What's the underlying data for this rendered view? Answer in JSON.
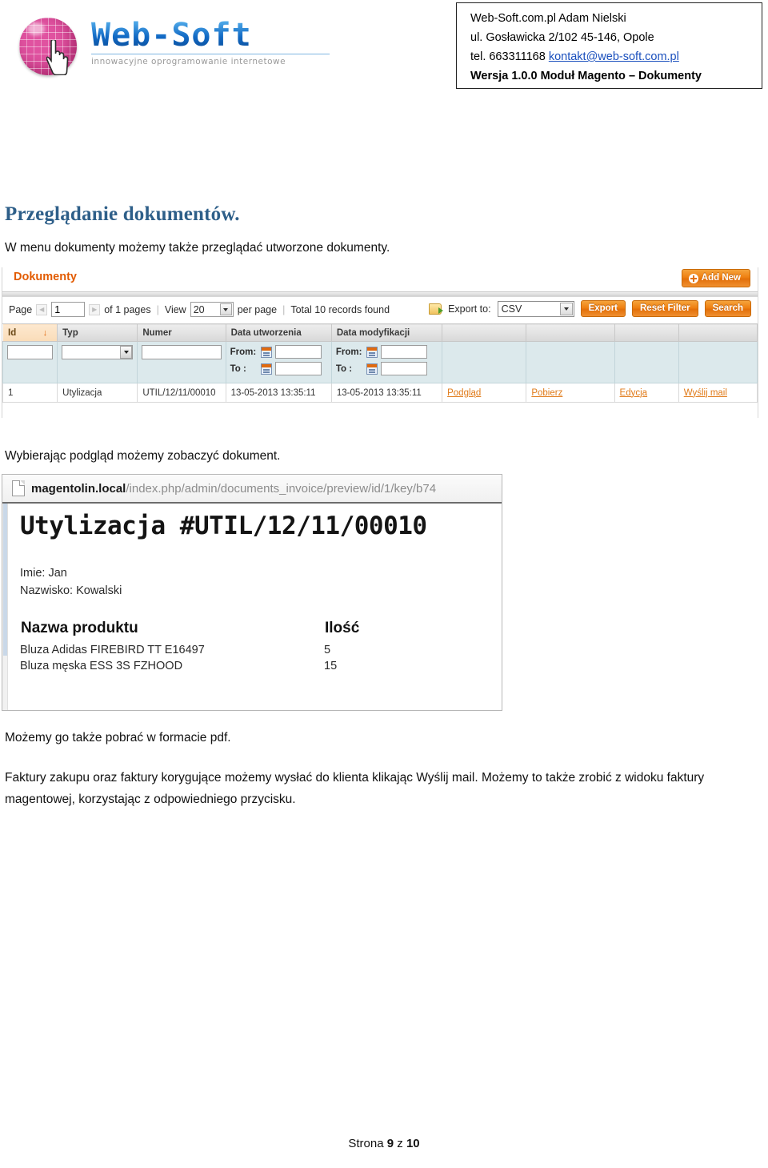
{
  "header": {
    "logo": {
      "wordmark": "Web-Soft",
      "tagline": "innowacyjne oprogramowanie internetowe",
      "globe_icon": "pink-globe-icon",
      "cursor_icon": "hand-cursor-icon"
    },
    "address_box": {
      "line1": "Web-Soft.com.pl Adam Nielski",
      "line2": "ul. Gosławicka 2/102 45-146, Opole",
      "line3_prefix": "tel. 663311168 ",
      "line3_email": "kontakt@web-soft.com.pl",
      "line4": "Wersja 1.0.0 Moduł Magento – Dokumenty"
    }
  },
  "content": {
    "title": "Przeglądanie dokumentów.",
    "intro": "W menu dokumenty możemy także przeglądać utworzone dokumenty.",
    "preview_caption": "Wybierając podgląd możemy zobaczyć dokument.",
    "pdf_note": "Możemy go także pobrać w formacie pdf.",
    "tail": "Faktury zakupu oraz faktury korygujące możemy wysłać do klienta klikając Wyślij mail. Możemy to także zrobić z widoku faktury magentowej, korzystając z odpowiedniego przycisku."
  },
  "grid_screenshot": {
    "panel_title": "Dokumenty",
    "add_new_label": "Add New",
    "toolbar": {
      "page_label": "Page",
      "page_value": "1",
      "of_pages": "of 1 pages",
      "view_label": "View",
      "view_value": "20",
      "per_page": "per page",
      "total_records": "Total 10 records found",
      "export_to_label": "Export to:",
      "export_format": "CSV",
      "export_button": "Export",
      "reset_filter_button": "Reset Filter",
      "search_button": "Search"
    },
    "columns": [
      "Id",
      "Typ",
      "Numer",
      "Data utworzenia",
      "Data modyfikacji",
      "",
      "",
      "",
      ""
    ],
    "sorted_column": "Id",
    "sort_arrow": "↓",
    "filters": {
      "from_label": "From:",
      "to_label": "To :"
    },
    "rows": [
      {
        "id": "1",
        "typ": "Utylizacja",
        "numer": "UTIL/12/11/00010",
        "data_utworzenia": "13-05-2013 13:35:11",
        "data_modyfikacji": "13-05-2013 13:35:11",
        "action_preview": "Podgląd",
        "action_download": "Pobierz",
        "action_edit": "Edycja",
        "action_mail": "Wyślij mail"
      }
    ]
  },
  "preview_screenshot": {
    "url_host": "magentolin.local",
    "url_path": "/index.php/admin/documents_invoice/preview/id/1/key/b74",
    "doc_title": "Utylizacja #UTIL/12/11/00010",
    "fields": [
      "Imie: Jan",
      "Nazwisko: Kowalski"
    ],
    "product_table": {
      "col_name": "Nazwa produktu",
      "col_qty": "Ilość",
      "rows": [
        {
          "name": "Bluza Adidas FIREBIRD TT E16497",
          "qty": "5"
        },
        {
          "name": "Bluza męska ESS 3S FZHOOD",
          "qty": "15"
        }
      ]
    }
  },
  "footer": {
    "prefix": "Strona ",
    "page": "9",
    "middle": " z ",
    "total": "10"
  },
  "colors": {
    "heading_blue": "#2e5f89",
    "magento_orange": "#e25b01",
    "link_blue": "#1a4fbd",
    "action_link": "#e07a18"
  }
}
